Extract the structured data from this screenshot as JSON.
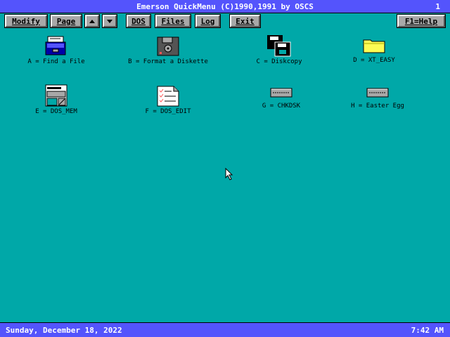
{
  "title": "Emerson QuickMenu (C)1990,1991 by OSCS",
  "page_number": "1",
  "toolbar": {
    "modify": "Modify",
    "page": "Page",
    "dos": "DOS",
    "files": "Files",
    "log": "Log",
    "exit": "Exit",
    "help": "F1=Help"
  },
  "items": {
    "a": "A = Find a File",
    "b": "B = Format a Diskette",
    "c": "C = Diskcopy",
    "d": "D = XT_EASY",
    "e": "E = DOS_MEM",
    "f": "F = DOS_EDIT",
    "g": "G = CHKDSK",
    "h": "H = Easter Egg"
  },
  "status": {
    "date": "Sunday, December 18, 2022",
    "time": "7:42 AM"
  },
  "colors": {
    "desktop": "#00a8a8",
    "bar": "#5454fc",
    "button": "#a8a8a8"
  }
}
